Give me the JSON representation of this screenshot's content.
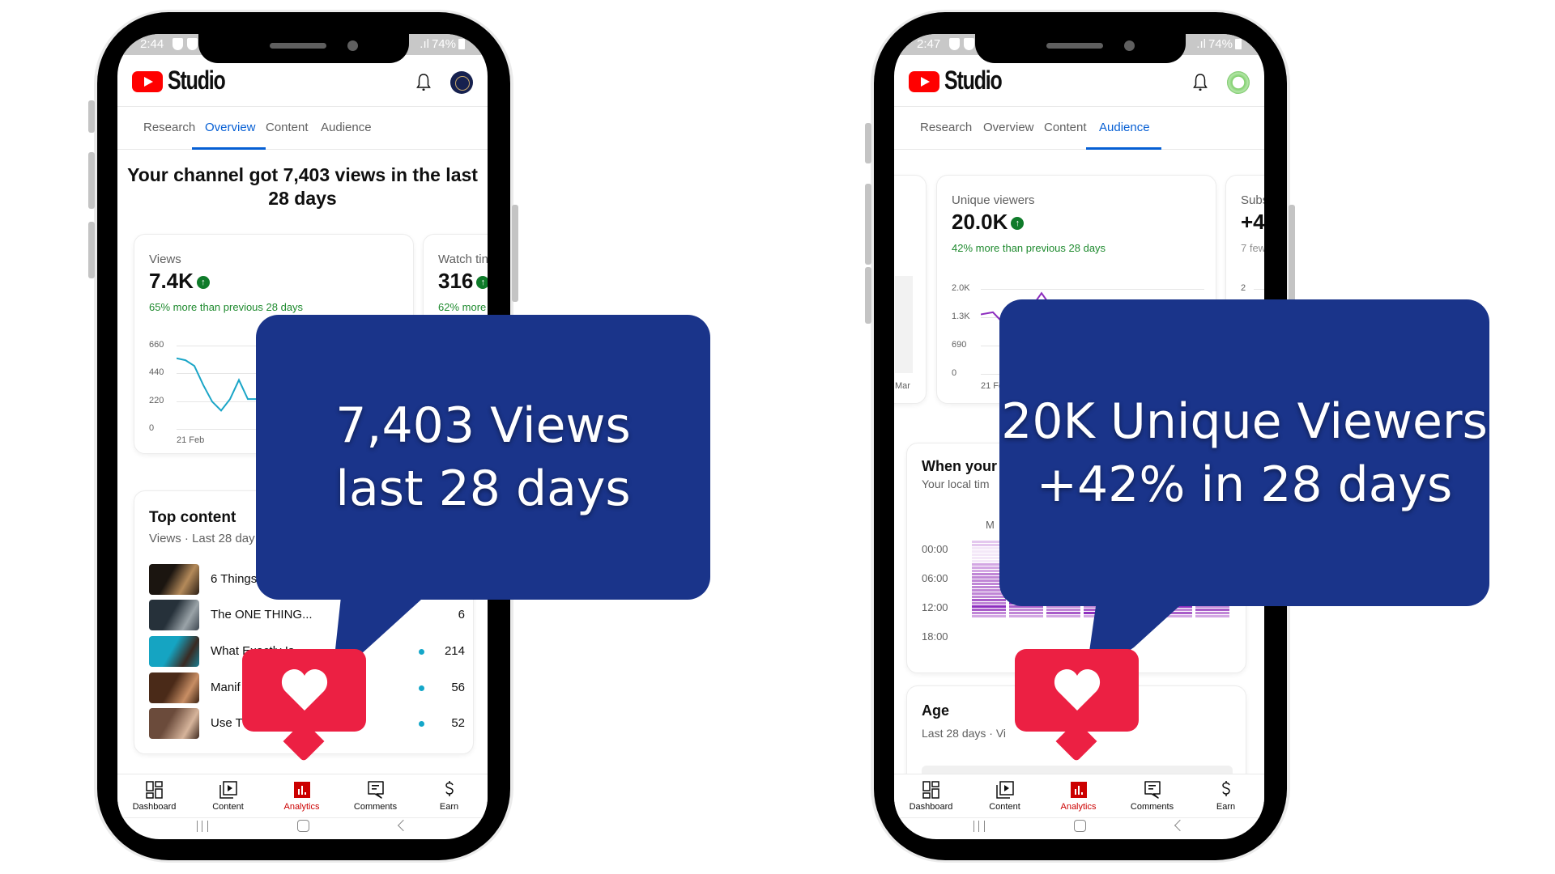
{
  "left_phone": {
    "status": {
      "time": "2:44",
      "battery": "74%"
    },
    "app_name": "Studio",
    "tabs": [
      {
        "label": "Research",
        "active": false
      },
      {
        "label": "Overview",
        "active": true
      },
      {
        "label": "Content",
        "active": false
      },
      {
        "label": "Audience",
        "active": false
      }
    ],
    "headline": "Your channel got 7,403 views in the last 28 days",
    "metrics": [
      {
        "label": "Views",
        "value": "7.4K",
        "delta": "65% more than previous 28 days"
      },
      {
        "label": "Watch tin",
        "value": "316",
        "delta": "62% more t"
      }
    ],
    "views_chart": {
      "y_ticks": [
        "660",
        "440",
        "220",
        "0"
      ],
      "x_label": "21 Feb",
      "line_color": "#1aa5c7",
      "values": [
        560,
        545,
        500,
        350,
        220,
        150,
        240,
        390,
        240,
        240,
        200
      ]
    },
    "top_content": {
      "title": "Top content",
      "subtitle": "Views · Last 28 day",
      "items": [
        {
          "title": "6 Things",
          "value": ""
        },
        {
          "title": "The ONE THING...",
          "value": "6"
        },
        {
          "title": "What Exactly Is...",
          "value": "214"
        },
        {
          "title": "Manif",
          "value": "56"
        },
        {
          "title": "Use T",
          "value": "52"
        }
      ]
    },
    "callout": {
      "line1": "7,403 Views",
      "line2": "last 28 days"
    }
  },
  "right_phone": {
    "status": {
      "time": "2:47",
      "battery": "74%"
    },
    "app_name": "Studio",
    "tabs": [
      {
        "label": "Research",
        "active": false
      },
      {
        "label": "Overview",
        "active": false
      },
      {
        "label": "Content",
        "active": false
      },
      {
        "label": "Audience",
        "active": true
      }
    ],
    "prev_card_x_label": "Mar",
    "metrics": [
      {
        "label": "Unique viewers",
        "value": "20.0K",
        "delta": "42% more than previous 28 days"
      },
      {
        "label": "Subs",
        "value": "+4",
        "delta": "7 few"
      }
    ],
    "viewers_chart": {
      "y_ticks": [
        "2.0K",
        "1.3K",
        "690",
        "0"
      ],
      "x_label": "21 Fe",
      "line_color": "#8e2fbf",
      "values": [
        1400,
        1450,
        1150,
        900,
        1500,
        1900,
        1500
      ]
    },
    "subs_tick": "2",
    "when_card": {
      "title": "When your",
      "subtitle": "Your local tim",
      "day_label": "M",
      "hours": [
        "00:00",
        "06:00",
        "12:00",
        "18:00"
      ]
    },
    "age_card": {
      "title": "Age",
      "subtitle": "Last 28 days · Vi"
    },
    "callout": {
      "line1": "20K Unique Viewers",
      "line2": "+42% in 28 days"
    }
  },
  "bottom_nav": [
    {
      "label": "Dashboard",
      "icon": "dashboard-icon",
      "active": false
    },
    {
      "label": "Content",
      "icon": "content-icon",
      "active": false
    },
    {
      "label": "Analytics",
      "icon": "analytics-icon",
      "active": true
    },
    {
      "label": "Comments",
      "icon": "comments-icon",
      "active": false
    },
    {
      "label": "Earn",
      "icon": "earn-icon",
      "active": false
    }
  ],
  "colors": {
    "callout_bg": "#1a348a",
    "heart_badge": "#ec2043",
    "youtube_red": "#ff0000",
    "active_tab": "#065fd4",
    "positive": "#1e8a2e"
  }
}
